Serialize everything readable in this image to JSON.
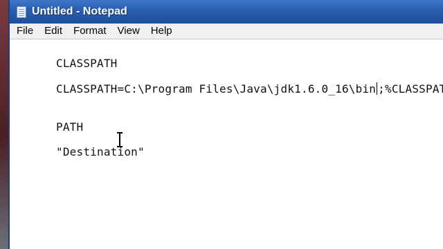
{
  "window": {
    "title": "Untitled - Notepad",
    "app_icon": "notepad-icon"
  },
  "menubar": {
    "items": [
      {
        "label": "File"
      },
      {
        "label": "Edit"
      },
      {
        "label": "Format"
      },
      {
        "label": "View"
      },
      {
        "label": "Help"
      }
    ]
  },
  "editor": {
    "lines": [
      {
        "text": "CLASSPATH"
      },
      {
        "text_before_caret": "CLASSPATH=C:\\Program Files\\Java\\jdk1.6.0_16\\bin",
        "text_after_caret": ";%CLASSPATH%"
      },
      {
        "text": "PATH"
      },
      {
        "text": "\"Destination\""
      }
    ]
  },
  "colors": {
    "titlebar": "#2a5fb0",
    "menubar": "#f0f0f0",
    "editor_bg": "#ffffff",
    "desktop": "#5a2a2e"
  }
}
